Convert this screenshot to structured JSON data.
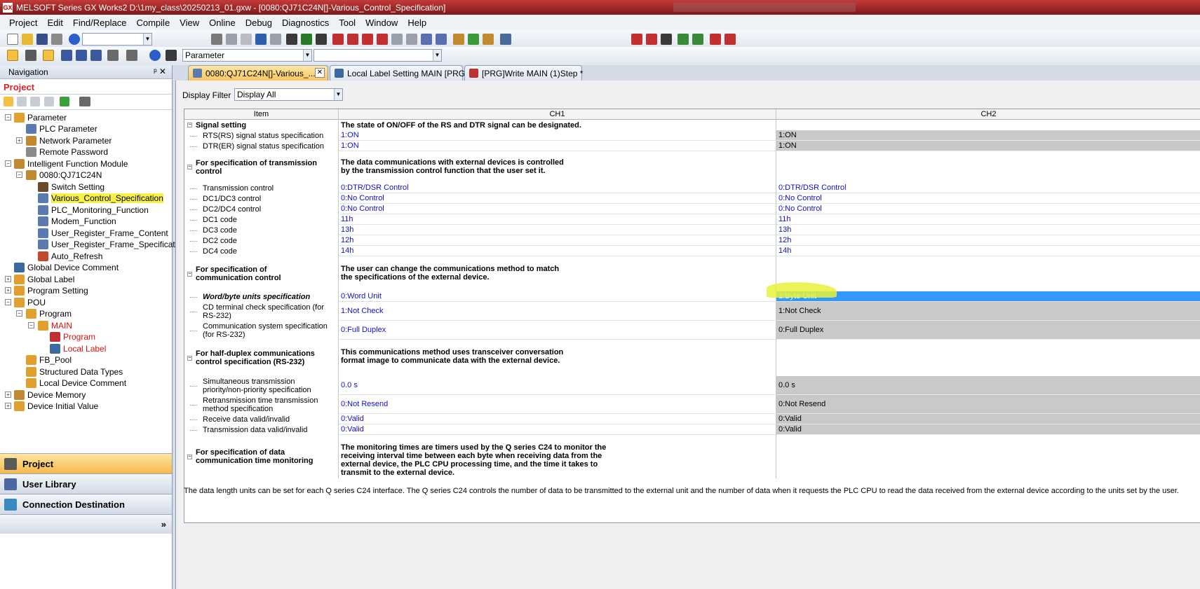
{
  "window": {
    "title": "MELSOFT Series GX Works2 D:\\1my_class\\20250213_01.gxw - [0080:QJ71C24N[]-Various_Control_Specification]"
  },
  "menu": [
    "Project",
    "Edit",
    "Find/Replace",
    "Compile",
    "View",
    "Online",
    "Debug",
    "Diagnostics",
    "Tool",
    "Window",
    "Help"
  ],
  "toolbar": {
    "view_combo": "Parameter"
  },
  "nav": {
    "header": "Navigation",
    "project_label": "Project",
    "tree": [
      {
        "label": "Parameter"
      },
      {
        "label": "PLC Parameter"
      },
      {
        "label": "Network Parameter"
      },
      {
        "label": "Remote Password"
      },
      {
        "label": "Intelligent Function Module"
      },
      {
        "label": "0080:QJ71C24N"
      },
      {
        "label": "Switch Setting"
      },
      {
        "label": "Various_Control_Specification"
      },
      {
        "label": "PLC_Monitoring_Function"
      },
      {
        "label": "Modem_Function"
      },
      {
        "label": "User_Register_Frame_Content"
      },
      {
        "label": "User_Register_Frame_Specification"
      },
      {
        "label": "Auto_Refresh"
      },
      {
        "label": "Global Device Comment"
      },
      {
        "label": "Global Label"
      },
      {
        "label": "Program Setting"
      },
      {
        "label": "POU"
      },
      {
        "label": "Program"
      },
      {
        "label": "MAIN"
      },
      {
        "label": "Program"
      },
      {
        "label": "Local Label"
      },
      {
        "label": "FB_Pool"
      },
      {
        "label": "Structured Data Types"
      },
      {
        "label": "Local Device Comment"
      },
      {
        "label": "Device Memory"
      },
      {
        "label": "Device Initial Value"
      }
    ],
    "bottom": [
      "Project",
      "User Library",
      "Connection Destination"
    ]
  },
  "tabs": [
    "0080:QJ71C24N[]-Various_...",
    "Local Label Setting MAIN [PRG]",
    "[PRG]Write MAIN (1)Step *"
  ],
  "filter": {
    "label": "Display Filter",
    "value": "Display All"
  },
  "table": {
    "columns": [
      "Item",
      "CH1",
      "CH2"
    ],
    "rows": [
      {
        "item": "Signal setting",
        "ch1": "The state of ON/OFF of the RS and DTR signal can be designated.",
        "ch2": ""
      },
      {
        "item": "RTS(RS) signal status specification",
        "ch1": "1:ON",
        "ch2": "1:ON"
      },
      {
        "item": "DTR(ER) signal status specification",
        "ch1": "1:ON",
        "ch2": "1:ON"
      },
      {
        "item": "For specification of transmission control",
        "ch1": "The data communications with external devices is controlled by the transmission control function that the user set it.",
        "ch2": ""
      },
      {
        "item": "Transmission control",
        "ch1": "0:DTR/DSR Control",
        "ch2": "0:DTR/DSR Control"
      },
      {
        "item": "DC1/DC3 control",
        "ch1": "0:No Control",
        "ch2": "0:No Control"
      },
      {
        "item": "DC2/DC4 control",
        "ch1": "0:No Control",
        "ch2": "0:No Control"
      },
      {
        "item": "DC1 code",
        "ch1": "11h",
        "ch2": "11h"
      },
      {
        "item": "DC3 code",
        "ch1": "13h",
        "ch2": "13h"
      },
      {
        "item": "DC2 code",
        "ch1": "12h",
        "ch2": "12h"
      },
      {
        "item": "DC4 code",
        "ch1": "14h",
        "ch2": "14h"
      },
      {
        "item": "For specification of communication control",
        "ch1": "The user can change the communications method to match the specifications of the external device.",
        "ch2": ""
      },
      {
        "item": "Word/byte units specification",
        "ch1": "0:Word Unit",
        "ch2": "1:Byte Unit"
      },
      {
        "item": "CD terminal check specification (for RS-232)",
        "ch1": "1:Not Check",
        "ch2": "1:Not Check"
      },
      {
        "item": "Communication system specification (for RS-232)",
        "ch1": "0:Full Duplex",
        "ch2": "0:Full Duplex"
      },
      {
        "item": "For half-duplex communications control specification (RS-232)",
        "ch1": "This communications method uses transceiver conversation format image to communicate data with the external device.",
        "ch2": ""
      },
      {
        "item": "Simultaneous transmission priority/non-priority specification",
        "ch1": "0.0 s",
        "ch2": "0.0 s"
      },
      {
        "item": "Retransmission time transmission method specification",
        "ch1": "0:Not Resend",
        "ch2": "0:Not Resend"
      },
      {
        "item": "Receive data valid/invalid",
        "ch1": "0:Valid",
        "ch2": "0:Valid"
      },
      {
        "item": "Transmission data valid/invalid",
        "ch1": "0:Valid",
        "ch2": "0:Valid"
      },
      {
        "item": "For specification of data communication time monitoring",
        "ch1": "The monitoring times are timers used by the Q series C24 to monitor the receiving interval time between each byte when receiving data from the external device, the PLC CPU processing time, and the time it takes to transmit to the external device.",
        "ch2": ""
      }
    ]
  },
  "description": "The data length units can be set for each Q series C24 interface. The Q series C24 controls the number of data to be transmitted to the external unit and the number of data when it requests the PLC CPU to read the data received from the external device according to the units set by the user."
}
